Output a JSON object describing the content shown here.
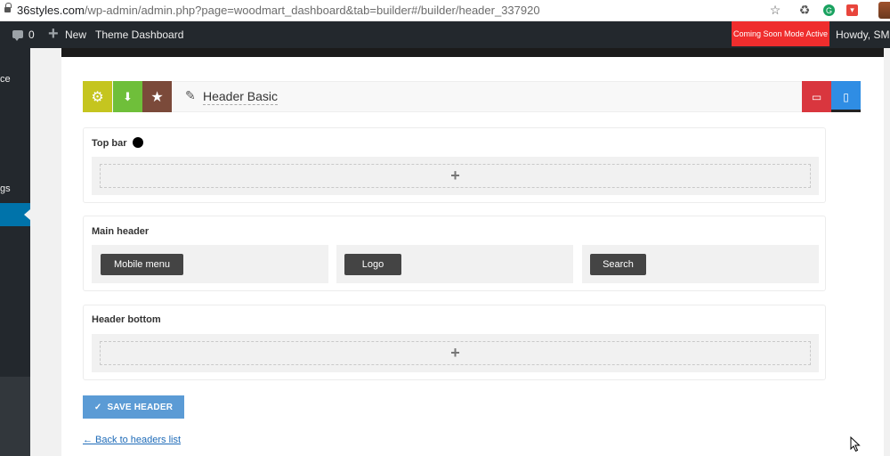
{
  "browser": {
    "url_host": "36styles.com",
    "url_path": "/wp-admin/admin.php?page=woodmart_dashboard&tab=builder#/builder/header_337920",
    "icons": [
      "lock-icon",
      "star-icon",
      "recycle-icon",
      "grammarly-icon",
      "pocket-icon",
      "profile-avatar"
    ]
  },
  "adminbar": {
    "comments_count": "0",
    "new_label": "New",
    "theme_dashboard_label": "Theme Dashboard",
    "coming_soon_label": "Coming Soon Mode Active",
    "howdy_label": "Howdy, SMK"
  },
  "sidebar": {
    "item_1_fragment": "ce",
    "item_2_fragment": "gs"
  },
  "toolbar": {
    "header_name": "Header Basic",
    "colors": {
      "settings": "#c5c51f",
      "import": "#6fbf3a",
      "favorite": "#7b4a3a",
      "desktop": "#d9363e",
      "mobile": "#2f8de4"
    }
  },
  "sections": {
    "top_bar": {
      "title": "Top bar",
      "add_symbol": "+"
    },
    "main_header": {
      "title": "Main header",
      "elements": [
        "Mobile menu",
        "Logo",
        "Search"
      ]
    },
    "header_bottom": {
      "title": "Header bottom",
      "add_symbol": "+"
    }
  },
  "actions": {
    "save_label": "SAVE HEADER",
    "back_link": "← Back to headers list"
  }
}
